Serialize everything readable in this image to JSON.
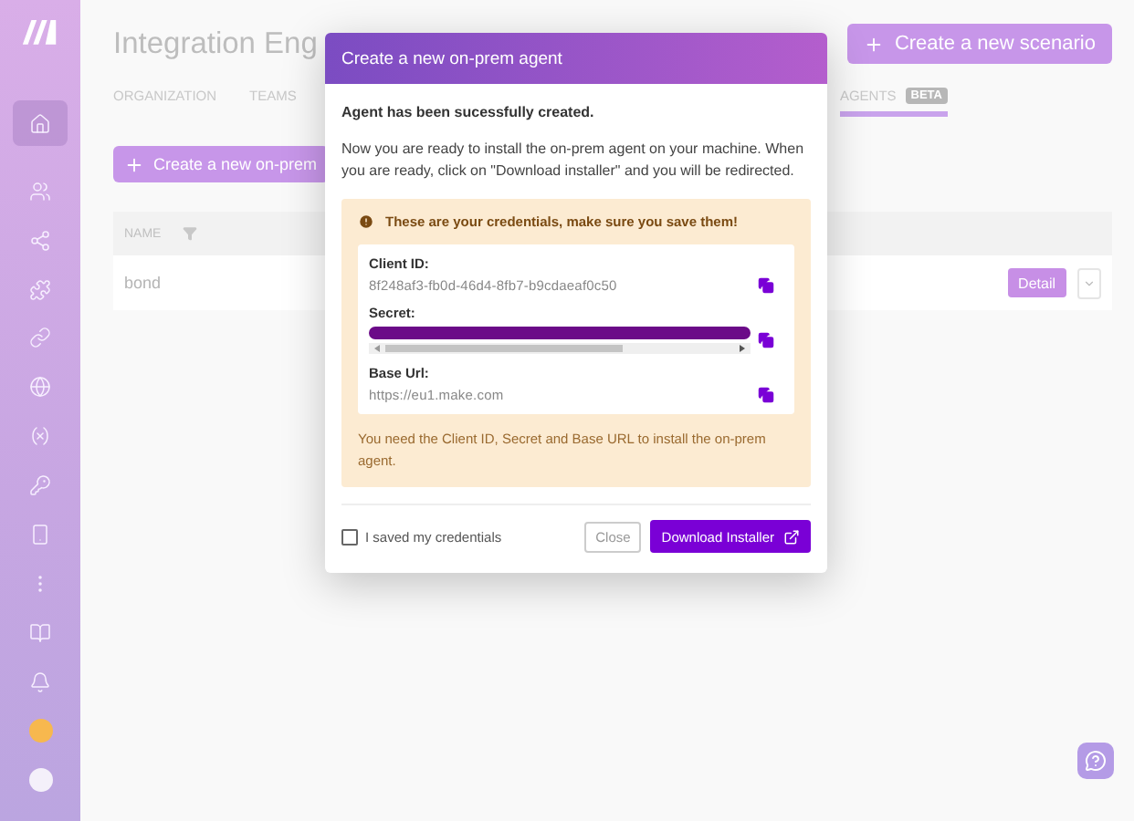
{
  "sidebar": {
    "items": [
      {
        "selected": true
      },
      {
        "selected": false
      },
      {
        "selected": false
      },
      {
        "selected": false
      },
      {
        "selected": false
      },
      {
        "selected": false
      },
      {
        "selected": false
      },
      {
        "selected": false
      },
      {
        "selected": false
      },
      {
        "selected": false
      }
    ]
  },
  "header": {
    "title": "Integration Eng",
    "create_button": "Create a new scenario"
  },
  "tabs": [
    {
      "label": "ORGANIZATION",
      "selected": false
    },
    {
      "label": "TEAMS",
      "selected": false
    },
    {
      "label": "AGENTS",
      "selected": true,
      "badge": "BETA"
    }
  ],
  "create_agent_button": "Create a new on-prem",
  "table": {
    "columns": [
      "NAME"
    ],
    "rows": [
      {
        "name": "bond",
        "detail_button": "Detail"
      }
    ]
  },
  "dialog": {
    "title": "Create a new on-prem agent",
    "heading": "Agent has been sucessfully created.",
    "message": "Now you are ready to install the on-prem agent on your machine. When you are ready, click on \"Download installer\" and you will be redirected.",
    "warning": "These are your credentials, make sure you save them!",
    "fields": [
      {
        "kind": "text",
        "label": "Client ID:",
        "value": "8f248af3-fb0d-46d4-8fb7-b9cdaeaf0c50"
      },
      {
        "kind": "secret",
        "label": "Secret:"
      },
      {
        "kind": "text",
        "label": "Base Url:",
        "value": "https://eu1.make.com"
      }
    ],
    "note": "You need the Client ID, Secret and Base URL to install the on-prem agent.",
    "checkbox": {
      "label": "I saved my credentials",
      "checked": false
    },
    "close_button": "Close",
    "download_button": "Download Installer"
  }
}
